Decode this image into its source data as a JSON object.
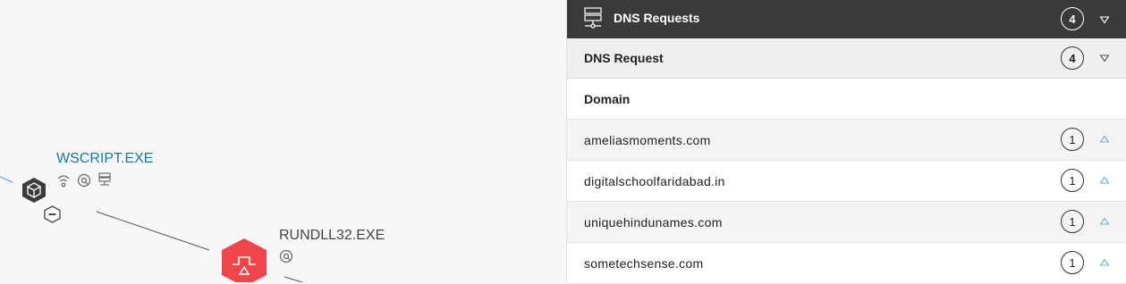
{
  "graph": {
    "nodes": [
      {
        "label": "WSCRIPT.EXE",
        "icon": "cube-icon",
        "color": "#1a7a9a"
      },
      {
        "label": "RUNDLL32.EXE",
        "icon": "process-alert-icon",
        "color": "#f0464b"
      }
    ]
  },
  "panel": {
    "title": "DNS Requests",
    "count": "4",
    "section": {
      "title": "DNS Request",
      "count": "4",
      "column_header": "Domain",
      "rows": [
        {
          "domain": "ameliasmoments.com",
          "count": "1"
        },
        {
          "domain": "digitalschoolfaridabad.in",
          "count": "1"
        },
        {
          "domain": "uniquehindunames.com",
          "count": "1"
        },
        {
          "domain": "sometechsense.com",
          "count": "1"
        }
      ]
    }
  },
  "colors": {
    "header_bg": "#3a3a3a",
    "accent_teal": "#1a7a9a",
    "alert_red": "#f0464b",
    "chevron_blue": "#6ab7d8"
  }
}
